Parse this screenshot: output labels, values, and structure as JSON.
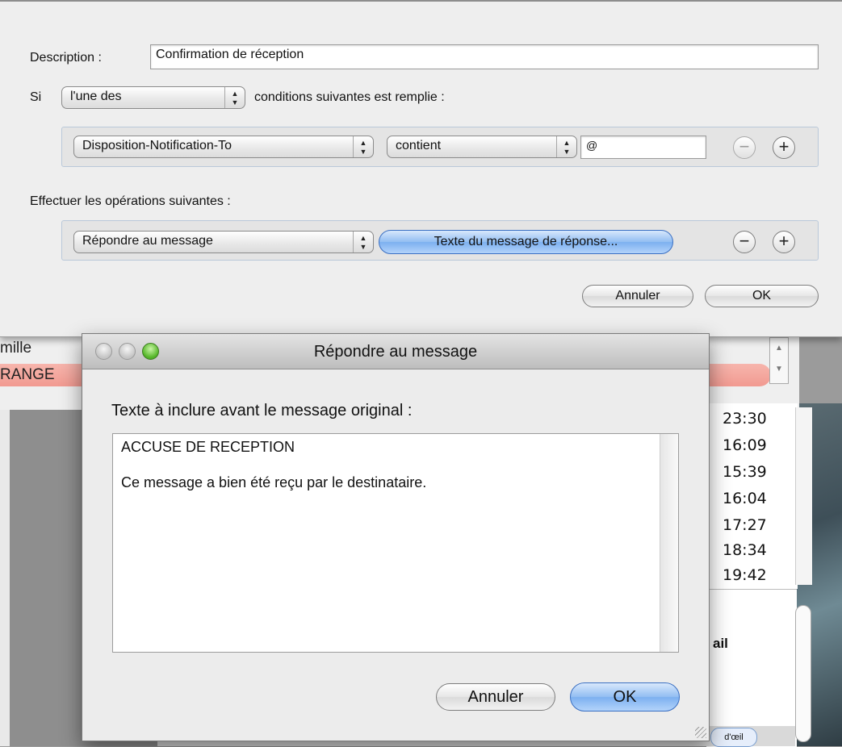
{
  "background": {
    "mail_label": "mille",
    "orange_row_text": "RANGE",
    "times": [
      "23:30",
      "16:09",
      "15:39",
      "16:04",
      "17:27",
      "18:34",
      "19:42"
    ],
    "preview_text": "ail",
    "coup_oeil_button": "d'œil"
  },
  "rules": {
    "description_label": "Description :",
    "description_value": "Confirmation de réception",
    "si_label": "Si",
    "match_popup": "l'une des",
    "conditions_text": "conditions suivantes est remplie :",
    "condition": {
      "header_popup": "Disposition-Notification-To",
      "operator_popup": "contient",
      "value": "@"
    },
    "actions_label": "Effectuer les opérations suivantes :",
    "action": {
      "action_popup": "Répondre au message",
      "message_button": "Texte du message de réponse..."
    },
    "remove_symbol": "−",
    "add_symbol": "+",
    "cancel_button": "Annuler",
    "ok_button": "OK"
  },
  "reply_dialog": {
    "title": "Répondre au message",
    "prompt": "Texte à inclure avant le message original :",
    "text_line1": "ACCUSE DE RECEPTION",
    "text_line2": "Ce message a bien été reçu par le destinataire.",
    "cancel_button": "Annuler",
    "ok_button": "OK"
  },
  "colors": {
    "accent_blue": "#7cb0f0",
    "orange_row": "#f19a91",
    "close_button_green": "#58b82c"
  }
}
